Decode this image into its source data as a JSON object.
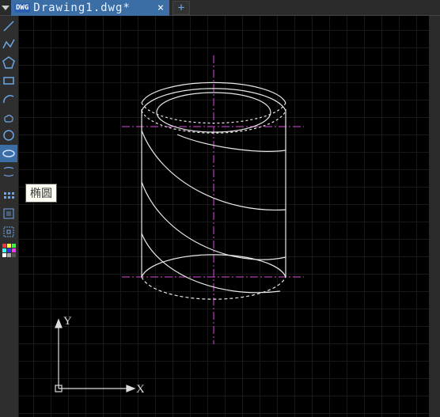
{
  "tabbar": {
    "file_badge": "DWG",
    "file_name": "Drawing1.dwg*",
    "close_glyph": "×",
    "add_glyph": "+"
  },
  "toolbar": {
    "items": [
      {
        "name": "line",
        "title": "直线"
      },
      {
        "name": "polyline",
        "title": "多段线"
      },
      {
        "name": "polygon",
        "title": "多边形"
      },
      {
        "name": "rectangle",
        "title": "矩形"
      },
      {
        "name": "arc",
        "title": "圆弧"
      },
      {
        "name": "revision-cloud",
        "title": "修订云线"
      },
      {
        "name": "circle",
        "title": "圆"
      },
      {
        "name": "ellipse",
        "title": "椭圆",
        "active": true,
        "tooltip": "椭圆"
      },
      {
        "name": "construction-line",
        "title": "构造线"
      },
      {
        "name": "more-tools",
        "title": "更多"
      },
      {
        "name": "block-insert",
        "title": "插入块"
      },
      {
        "name": "block-create",
        "title": "创建块"
      },
      {
        "name": "color-palette",
        "title": "颜色"
      }
    ]
  },
  "tooltip_text": "椭圆",
  "ucs": {
    "x_label": "X",
    "y_label": "Y"
  },
  "colors": {
    "tab_blue": "#3b6ea5",
    "icon_blue": "#6da6e8",
    "magenta": "#d94bd9",
    "canvas_bg": "#000000"
  }
}
